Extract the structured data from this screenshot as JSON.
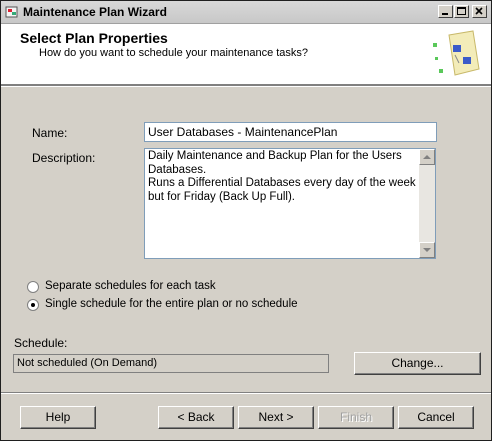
{
  "window": {
    "title": "Maintenance Plan Wizard"
  },
  "header": {
    "title": "Select Plan Properties",
    "subtitle": "How do you want to schedule your maintenance tasks?"
  },
  "form": {
    "name_label": "Name:",
    "name_value": "User Databases - MaintenancePlan",
    "description_label": "Description:",
    "description_value": "Daily Maintenance and Backup Plan for the Users Databases.\nRuns a Differential Databases every day of the week but for Friday (Back Up Full)."
  },
  "schedule_options": [
    {
      "label": "Separate schedules for each task",
      "selected": false
    },
    {
      "label": "Single schedule for the entire plan or no schedule",
      "selected": true
    }
  ],
  "schedule": {
    "label": "Schedule:",
    "value": "Not scheduled (On Demand)",
    "change_label": "Change..."
  },
  "buttons": {
    "help": "Help",
    "back": "< Back",
    "next": "Next >",
    "finish": "Finish",
    "cancel": "Cancel"
  }
}
